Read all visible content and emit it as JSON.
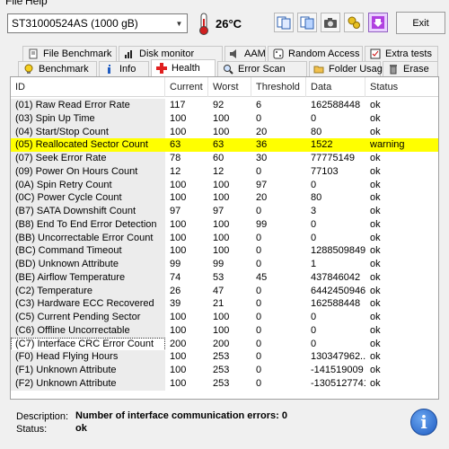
{
  "menu": {
    "file": "File",
    "help": "Help"
  },
  "toolbar": {
    "drive": "ST31000524AS (1000 gB)",
    "temperature": "26°C",
    "exit_label": "Exit"
  },
  "tabs_top": [
    {
      "label": "File Benchmark",
      "icon": "document-icon"
    },
    {
      "label": "Disk monitor",
      "icon": "chart-icon"
    },
    {
      "label": "AAM",
      "icon": "speaker-icon"
    },
    {
      "label": "Random Access",
      "icon": "dice-icon"
    },
    {
      "label": "Extra tests",
      "icon": "checklist-icon"
    }
  ],
  "tabs_bottom": [
    {
      "label": "Benchmark",
      "icon": "bulb-icon"
    },
    {
      "label": "Info",
      "icon": "info-icon"
    },
    {
      "label": "Health",
      "icon": "red-cross-icon",
      "active": true
    },
    {
      "label": "Error Scan",
      "icon": "magnifier-icon"
    },
    {
      "label": "Folder Usage",
      "icon": "folder-icon"
    },
    {
      "label": "Erase",
      "icon": "trash-icon"
    }
  ],
  "table": {
    "headers": [
      "ID",
      "Current",
      "Worst",
      "Threshold",
      "Data",
      "Status"
    ],
    "rows": [
      [
        "(01) Raw Read Error Rate",
        "117",
        "92",
        "6",
        "162588448",
        "ok"
      ],
      [
        "(03) Spin Up Time",
        "100",
        "100",
        "0",
        "0",
        "ok"
      ],
      [
        "(04) Start/Stop Count",
        "100",
        "100",
        "20",
        "80",
        "ok"
      ],
      [
        "(05) Reallocated Sector Count",
        "63",
        "63",
        "36",
        "1522",
        "warning"
      ],
      [
        "(07) Seek Error Rate",
        "78",
        "60",
        "30",
        "77775149",
        "ok"
      ],
      [
        "(09) Power On Hours Count",
        "12",
        "12",
        "0",
        "77103",
        "ok"
      ],
      [
        "(0A) Spin Retry Count",
        "100",
        "100",
        "97",
        "0",
        "ok"
      ],
      [
        "(0C) Power Cycle Count",
        "100",
        "100",
        "20",
        "80",
        "ok"
      ],
      [
        "(B7) SATA Downshift Count",
        "97",
        "97",
        "0",
        "3",
        "ok"
      ],
      [
        "(B8) End To End Error Detection",
        "100",
        "100",
        "99",
        "0",
        "ok"
      ],
      [
        "(BB) Uncorrectable Error Count",
        "100",
        "100",
        "0",
        "0",
        "ok"
      ],
      [
        "(BC) Command Timeout",
        "100",
        "100",
        "0",
        "12885098499",
        "ok"
      ],
      [
        "(BD) Unknown Attribute",
        "99",
        "99",
        "0",
        "1",
        "ok"
      ],
      [
        "(BE) Airflow Temperature",
        "74",
        "53",
        "45",
        "437846042",
        "ok"
      ],
      [
        "(C2) Temperature",
        "26",
        "47",
        "0",
        "64424509466",
        "ok"
      ],
      [
        "(C3) Hardware ECC Recovered",
        "39",
        "21",
        "0",
        "162588448",
        "ok"
      ],
      [
        "(C5) Current Pending Sector",
        "100",
        "100",
        "0",
        "0",
        "ok"
      ],
      [
        "(C6) Offline Uncorrectable",
        "100",
        "100",
        "0",
        "0",
        "ok"
      ],
      [
        "(C7) Interface CRC Error Count",
        "200",
        "200",
        "0",
        "0",
        "ok"
      ],
      [
        "(F0) Head Flying Hours",
        "100",
        "253",
        "0",
        "130347962...",
        "ok"
      ],
      [
        "(F1) Unknown Attribute",
        "100",
        "253",
        "0",
        "-141519009",
        "ok"
      ],
      [
        "(F2) Unknown Attribute",
        "100",
        "253",
        "0",
        "-1305127741",
        "ok"
      ]
    ]
  },
  "description": {
    "label": "Description:",
    "value": "Number of interface communication errors: 0",
    "status_label": "Status:",
    "status_value": "ok"
  },
  "colors": {
    "warning": "#ffff00",
    "accent": "#1e5bc2"
  }
}
